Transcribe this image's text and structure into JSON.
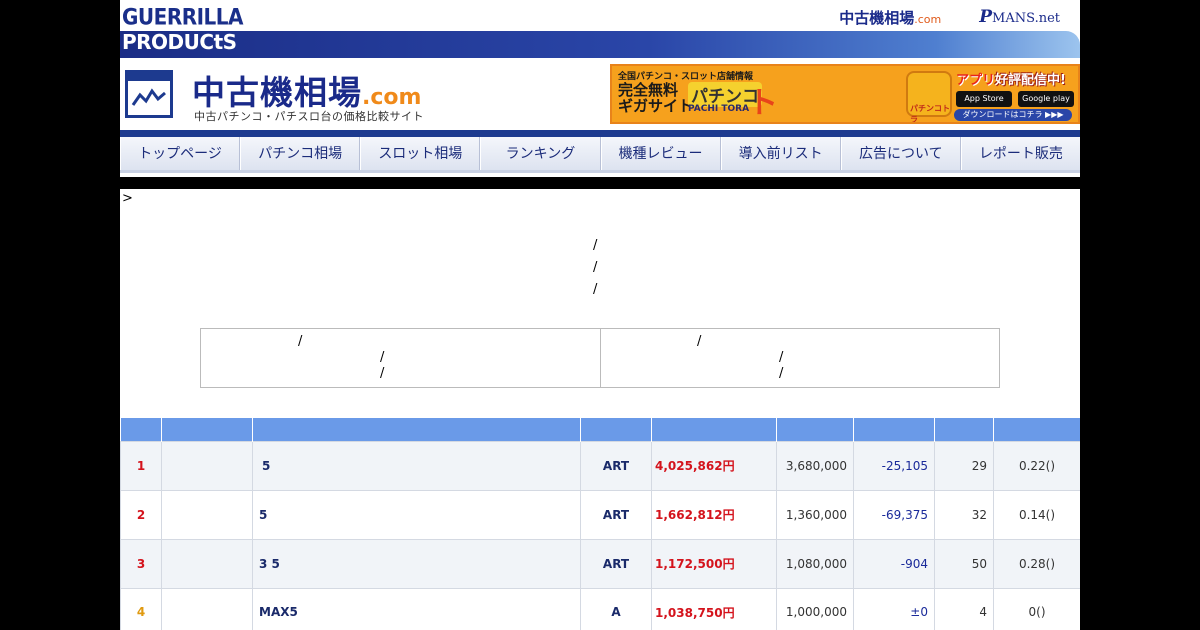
{
  "header": {
    "logo_line1": "GUERRILLA",
    "logo_line2": "PRODUCtS",
    "toplink_chuko": "中古機相場",
    "toplink_chuko_com": ".com",
    "toplink_pmans_p": "P",
    "toplink_pmans_rest": "MANS.net"
  },
  "brand": {
    "title": "中古機相場",
    "title_com": ".com",
    "subtitle": "中古パチンコ・パチスロ台の価格比較サイト"
  },
  "ad": {
    "small": "全国パチンコ・スロット店舗情報",
    "big1": "完全無料",
    "big2": "ギガサイト",
    "pachi": "パチンコ",
    "pachitora": "PACHI TORA",
    "tora": "トラ",
    "app_headline_em": "アプリ",
    "app_headline": "好評配信中!",
    "app_store": "App Store",
    "google_play": "Google play",
    "download": "ダウンロードはコチラ ▶▶▶",
    "icon_text": "パチンコトラ"
  },
  "nav": {
    "items": [
      "トップページ",
      "パチンコ相場",
      "スロット相場",
      "ランキング",
      "機種レビュー",
      "導入前リスト",
      "広告について",
      "レポート販売"
    ]
  },
  "content": {
    "breadcrumb": ">",
    "slash": "/"
  },
  "table": {
    "rows": [
      {
        "rank": "1",
        "name": " 5",
        "type": "ART",
        "price": "4,025,862円",
        "prev": "3,680,000",
        "diff": "-25,105",
        "count": "29",
        "rate": "0.22()"
      },
      {
        "rank": "2",
        "name": "5",
        "type": "ART",
        "price": "1,662,812円",
        "prev": "1,360,000",
        "diff": "-69,375",
        "count": "32",
        "rate": "0.14()"
      },
      {
        "rank": "3",
        "name": "3 5",
        "type": "ART",
        "price": "1,172,500円",
        "prev": "1,080,000",
        "diff": "-904",
        "count": "50",
        "rate": "0.28()"
      },
      {
        "rank": "4",
        "name": "MAX5",
        "type": "A",
        "price": "1,038,750円",
        "prev": "1,000,000",
        "diff": "±0",
        "count": "4",
        "rate": "0()"
      }
    ]
  },
  "colors": {
    "brand_navy": "#1a2a8a",
    "accent_orange": "#f08a1a",
    "table_header": "#6a9ae8",
    "price_red": "#d4131c",
    "rank4_gold": "#e09a10"
  }
}
